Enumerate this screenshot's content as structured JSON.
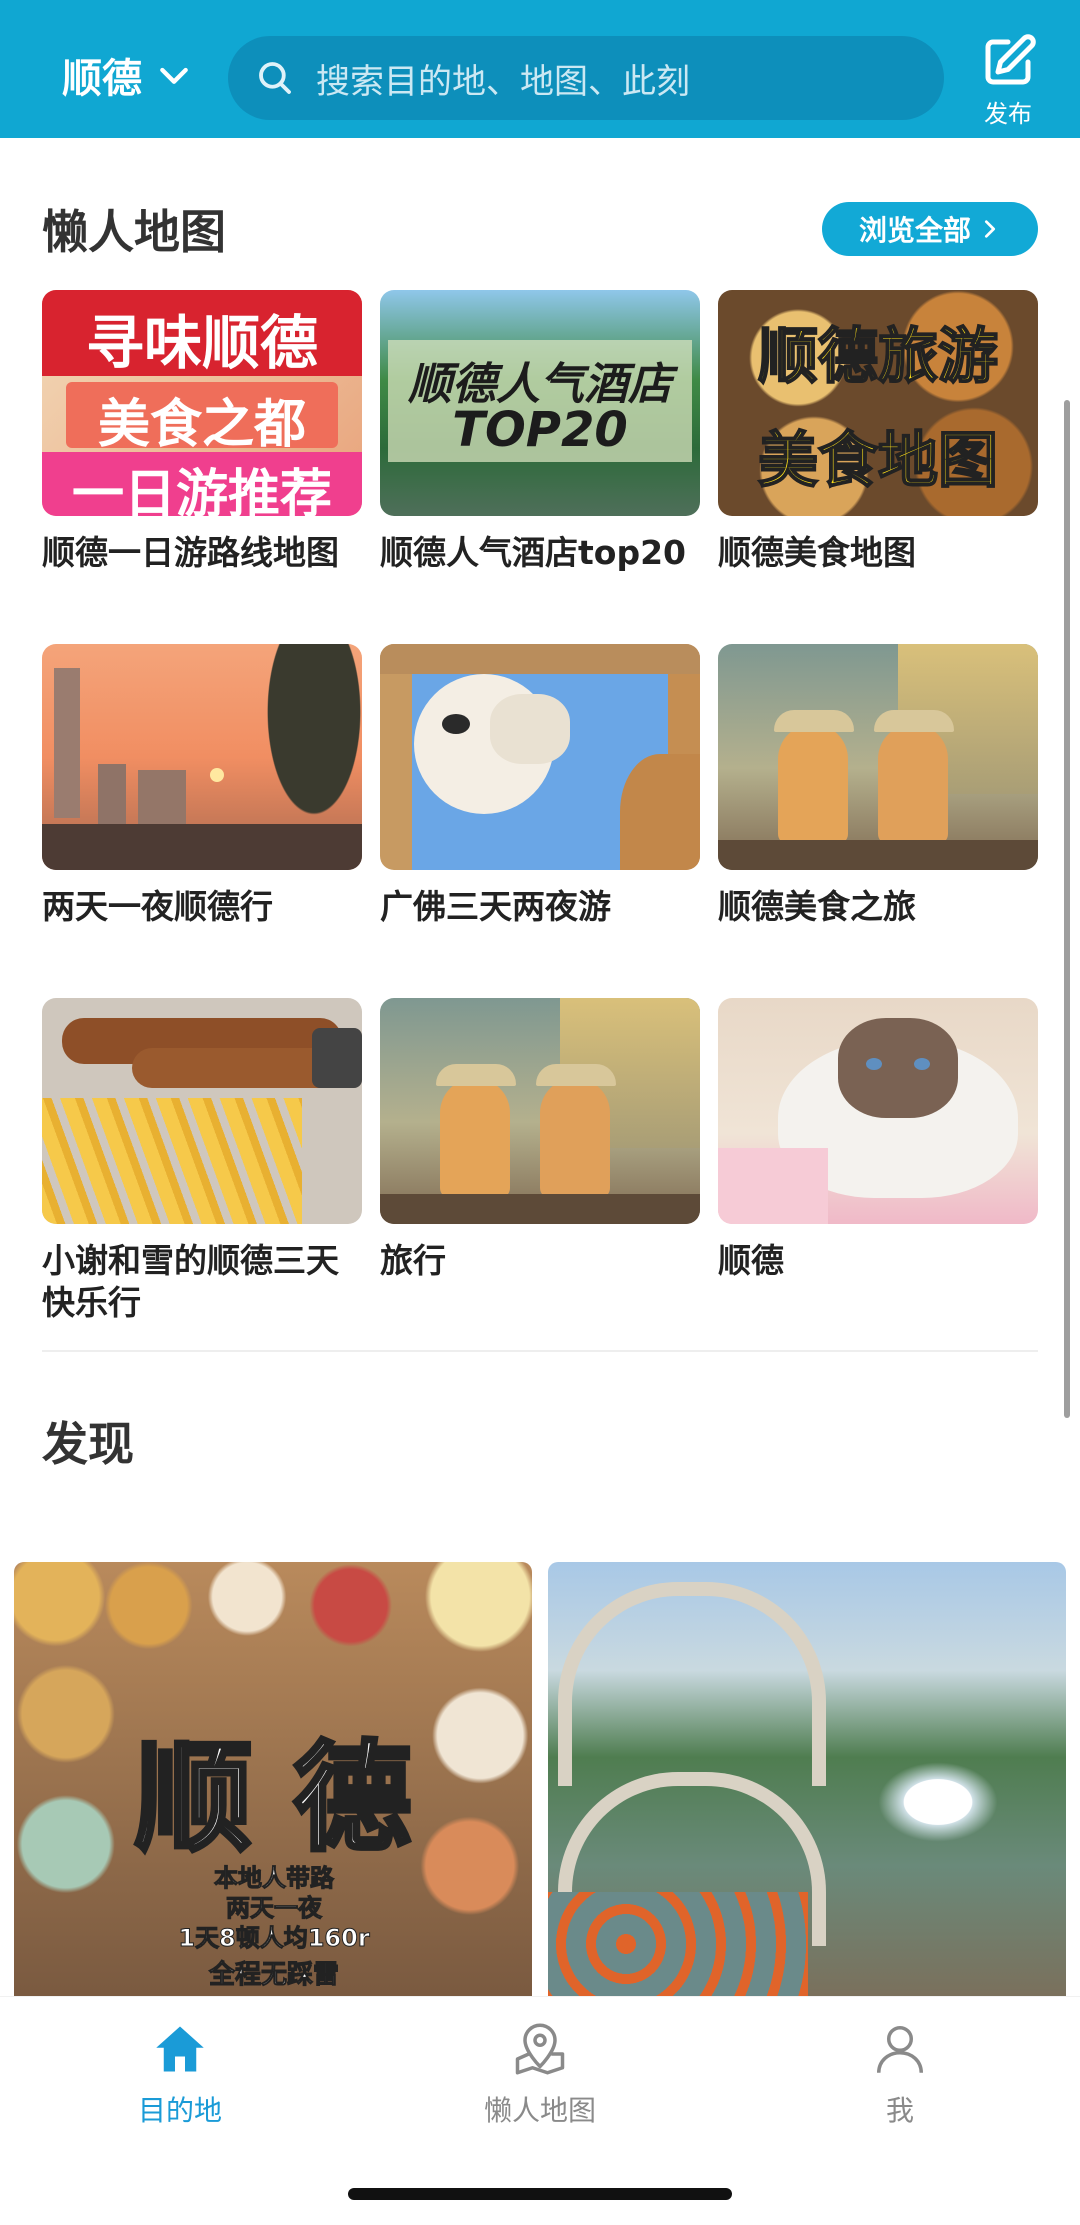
{
  "header": {
    "city": "顺德",
    "search_placeholder": "搜索目的地、地图、此刻",
    "publish_label": "发布"
  },
  "lazy_map": {
    "title": "懒人地图",
    "browse_all": "浏览全部",
    "cards": [
      {
        "label": "顺德一日游路线地图",
        "overlay": [
          "寻味顺德",
          "美食之都",
          "一日游推荐"
        ]
      },
      {
        "label": "顺德人气酒店top20",
        "overlay": [
          "顺德人气酒店",
          "TOP20"
        ]
      },
      {
        "label": "顺德美食地图",
        "overlay": [
          "顺德旅游",
          "美食地图"
        ]
      },
      {
        "label": "两天一夜顺德行",
        "overlay": []
      },
      {
        "label": "广佛三天两夜游",
        "overlay": []
      },
      {
        "label": "顺德美食之旅",
        "overlay": []
      },
      {
        "label": "小谢和雪的顺德三天快乐行",
        "overlay": []
      },
      {
        "label": "旅行",
        "overlay": []
      },
      {
        "label": "顺德",
        "overlay": []
      }
    ]
  },
  "discover": {
    "title": "发现",
    "feed": [
      {
        "overlay_title": "顺 德",
        "overlay_lines": [
          "本地人带路",
          "两天一夜",
          "1天8顿人均160r",
          "全程无踩雷"
        ]
      },
      {
        "overlay_title": "",
        "overlay_lines": []
      }
    ]
  },
  "tabbar": {
    "tabs": [
      {
        "label": "目的地",
        "icon": "home-icon",
        "active": true
      },
      {
        "label": "懒人地图",
        "icon": "map-pin-icon",
        "active": false
      },
      {
        "label": "我",
        "icon": "person-icon",
        "active": false
      }
    ]
  },
  "colors": {
    "brand": "#10a7d2",
    "active_tab": "#1a9bd7",
    "inactive_tab": "#8a8a8a"
  }
}
